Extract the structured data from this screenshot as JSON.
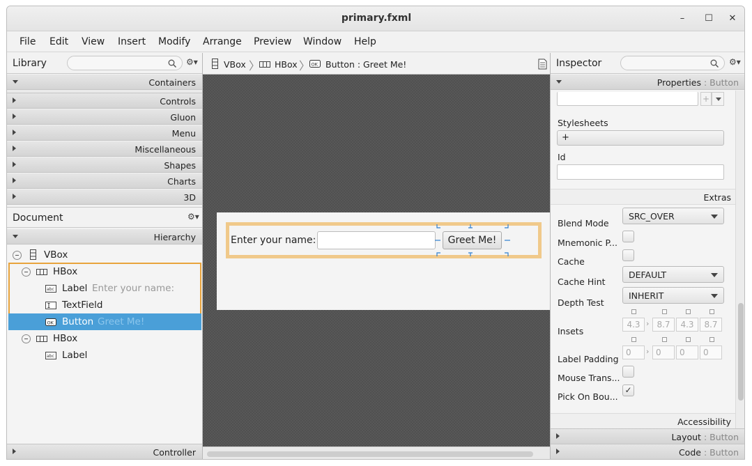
{
  "window": {
    "title": "primary.fxml",
    "minimize": "–",
    "maximize": "☐",
    "close": "✕"
  },
  "menu": [
    "File",
    "Edit",
    "View",
    "Insert",
    "Modify",
    "Arrange",
    "Preview",
    "Window",
    "Help"
  ],
  "library": {
    "title": "Library",
    "sections": [
      "Containers",
      "Controls",
      "Gluon",
      "Menu",
      "Miscellaneous",
      "Shapes",
      "Charts",
      "3D"
    ]
  },
  "document": {
    "title": "Document",
    "hierarchy_label": "Hierarchy",
    "tree": [
      {
        "type": "VBox",
        "extra": ""
      },
      {
        "type": "HBox",
        "extra": ""
      },
      {
        "type": "Label",
        "extra": "Enter your name:"
      },
      {
        "type": "TextField",
        "extra": ""
      },
      {
        "type": "Button",
        "extra": "Greet Me!"
      },
      {
        "type": "HBox",
        "extra": ""
      },
      {
        "type": "Label",
        "extra": ""
      }
    ],
    "controller_label": "Controller"
  },
  "breadcrumb": {
    "vbox": "VBox",
    "hbox": "HBox",
    "button": "Button : Greet Me!"
  },
  "stage": {
    "label": "Enter your name:",
    "button": "Greet Me!"
  },
  "inspector": {
    "title": "Inspector",
    "properties_section": "Properties",
    "properties_target": ": Button",
    "stylesheets_label": "Stylesheets",
    "stylesheets_add": "+",
    "id_label": "Id",
    "extras_label": "Extras",
    "blend_mode_label": "Blend Mode",
    "blend_mode_value": "SRC_OVER",
    "mnemonic_label": "Mnemonic P...",
    "cache_label": "Cache",
    "cache_hint_label": "Cache Hint",
    "cache_hint_value": "DEFAULT",
    "depth_test_label": "Depth Test",
    "depth_test_value": "INHERIT",
    "insets_label": "Insets",
    "insets_values": [
      "4.3",
      "8.7",
      "4.3",
      "8.7"
    ],
    "label_padding_label": "Label Padding",
    "label_padding_values": [
      "0",
      "0",
      "0",
      "0"
    ],
    "mouse_trans_label": "Mouse Trans...",
    "pick_on_bounds_label": "Pick On Bou...",
    "pick_on_bounds_checked": "✓",
    "accessibility_label": "Accessibility",
    "layout_section": "Layout",
    "layout_target": ": Button",
    "code_section": "Code",
    "code_target": ": Button"
  },
  "colors": {
    "selection": "#4a9fd8",
    "highlight_border": "#e8a33c",
    "stage_outline": "#f0c98a"
  }
}
